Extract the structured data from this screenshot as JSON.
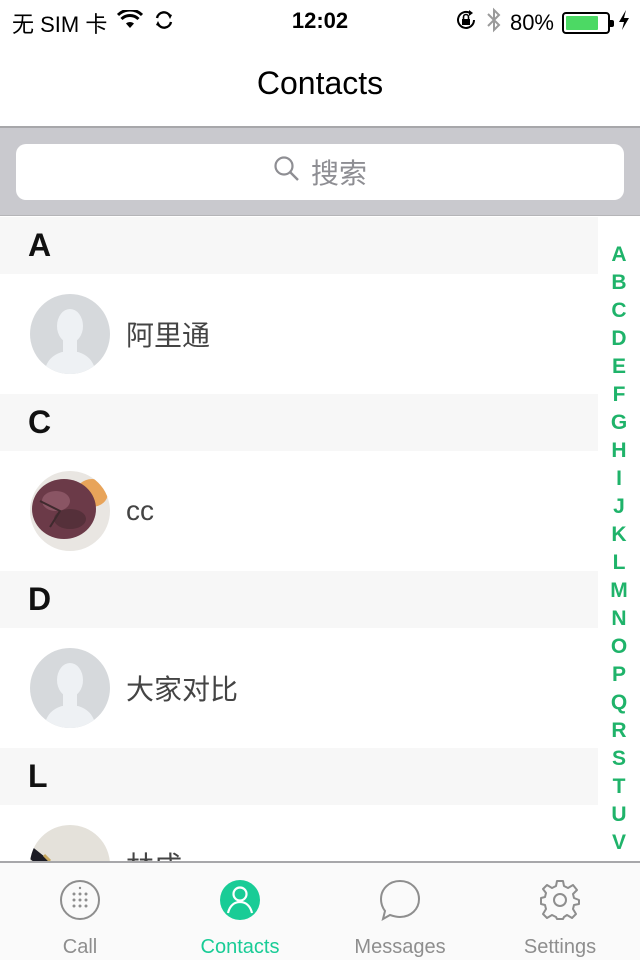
{
  "status_bar": {
    "carrier": "无 SIM 卡",
    "time": "12:02",
    "battery_percent": "80%",
    "battery_level": 0.8
  },
  "nav": {
    "title": "Contacts"
  },
  "search": {
    "placeholder": "搜索"
  },
  "sections": [
    {
      "letter": "A",
      "contacts": [
        {
          "name": "阿里通",
          "avatar": "default-avatar"
        }
      ]
    },
    {
      "letter": "C",
      "contacts": [
        {
          "name": "cc",
          "avatar": "photo-avatar"
        }
      ]
    },
    {
      "letter": "D",
      "contacts": [
        {
          "name": "大家对比",
          "avatar": "default-avatar"
        }
      ]
    },
    {
      "letter": "L",
      "contacts": [
        {
          "name": "林成",
          "avatar": "photo-avatar"
        }
      ]
    }
  ],
  "index_letters": [
    "A",
    "B",
    "C",
    "D",
    "E",
    "F",
    "G",
    "H",
    "I",
    "J",
    "K",
    "L",
    "M",
    "N",
    "O",
    "P",
    "Q",
    "R",
    "S",
    "T",
    "U",
    "V"
  ],
  "tabs": [
    {
      "label": "Call",
      "icon": "dialpad-icon",
      "active": false
    },
    {
      "label": "Contacts",
      "icon": "person-icon",
      "active": true
    },
    {
      "label": "Messages",
      "icon": "chat-bubble-icon",
      "active": false
    },
    {
      "label": "Settings",
      "icon": "gear-icon",
      "active": false
    }
  ],
  "colors": {
    "accent": "#19cc96",
    "index": "#1fb36a",
    "battery": "#4cd964"
  }
}
